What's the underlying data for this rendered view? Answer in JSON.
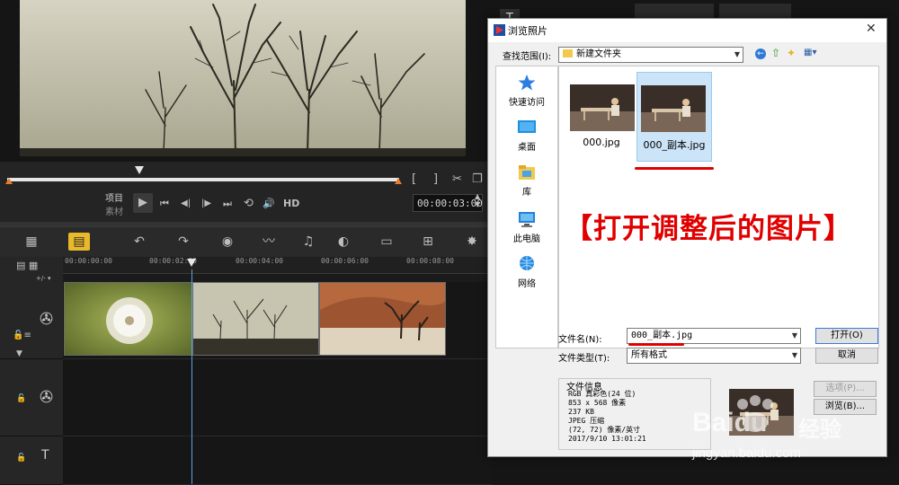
{
  "editor": {
    "mode_project": "项目",
    "mode_clip": "素材",
    "hd_label": "HD",
    "timecode": "00:00:03:00",
    "ruler_ticks": [
      "00:00:00:00",
      "00:00:02:00",
      "00:00:04:00",
      "00:00:06:00",
      "00:00:08:00"
    ],
    "controls": {
      "play": "▶",
      "home": "⏮",
      "prev_frame": "◀|",
      "next_frame": "|▶",
      "end": "⏭",
      "repeat": "⟲",
      "volume": "🔊"
    }
  },
  "dialog": {
    "title": "浏览照片",
    "lookin_label": "查找范围(I):",
    "lookin_value": "新建文件夹",
    "nav_items": [
      {
        "label": "快速访问",
        "icon": "star-icon"
      },
      {
        "label": "桌面",
        "icon": "desktop-icon"
      },
      {
        "label": "库",
        "icon": "library-icon"
      },
      {
        "label": "此电脑",
        "icon": "computer-icon"
      },
      {
        "label": "网络",
        "icon": "network-icon"
      }
    ],
    "files": [
      {
        "name": "000.jpg",
        "selected": false
      },
      {
        "name": "000_副本.jpg",
        "selected": true
      }
    ],
    "filename_label": "文件名(N):",
    "filename_value": "000_副本.jpg",
    "filetype_label": "文件类型(T):",
    "filetype_value": "所有格式",
    "open_button": "打开(O)",
    "cancel_button": "取消",
    "options_button": "选项(P)...",
    "browse_button": "浏览(B)...",
    "info_title": "文件信息",
    "info_lines": [
      "RGB 真彩色(24 位)",
      "853 x 568 像素",
      "237 KB",
      "JPEG 压缩",
      "(72, 72) 像素/英寸",
      "2017/9/10  13:01:21"
    ]
  },
  "annotation": "【打开调整后的图片】",
  "watermark": {
    "brand": "Baidu",
    "brand_cn": "经验",
    "url": "jingyan.baidu.com"
  },
  "colors": {
    "accent_red": "#e00000",
    "toolbar_highlight": "#e8b92b",
    "playhead_blue": "#5aa0e6",
    "selection_blue": "#cce4f7"
  }
}
